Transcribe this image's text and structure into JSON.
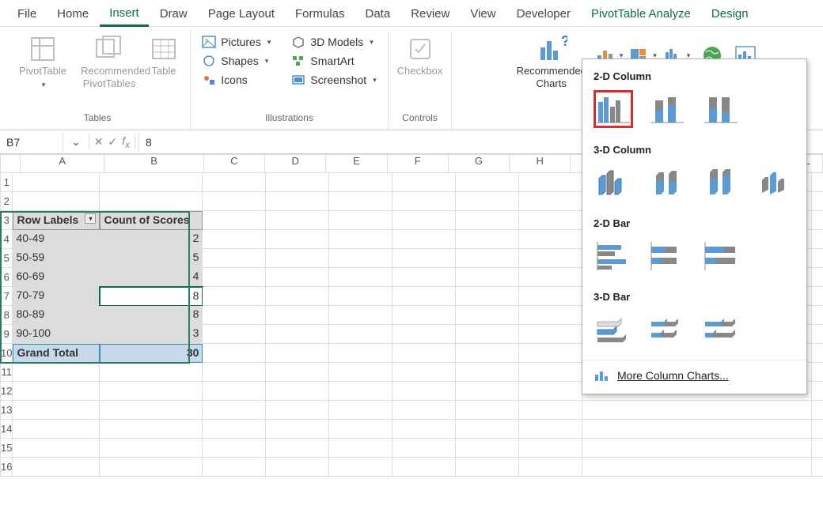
{
  "tabs": [
    "File",
    "Home",
    "Insert",
    "Draw",
    "Page Layout",
    "Formulas",
    "Data",
    "Review",
    "View",
    "Developer",
    "PivotTable Analyze",
    "Design"
  ],
  "active_tab": "Insert",
  "ribbon": {
    "tables": {
      "pivottable": "PivotTable",
      "recommended_pt": "Recommended\nPivotTables",
      "table": "Table",
      "group": "Tables"
    },
    "illustrations": {
      "pictures": "Pictures",
      "shapes": "Shapes",
      "icons": "Icons",
      "models": "3D Models",
      "smartart": "SmartArt",
      "screenshot": "Screenshot",
      "group": "Illustrations"
    },
    "controls": {
      "checkbox": "Checkbox",
      "group": "Controls"
    },
    "charts": {
      "recommended": "Recommended\nCharts"
    }
  },
  "name_box": "B7",
  "formula_bar": "8",
  "columns": [
    "A",
    "B",
    "C",
    "D",
    "E",
    "F",
    "G",
    "H",
    "L"
  ],
  "rows": [
    "1",
    "2",
    "3",
    "4",
    "5",
    "6",
    "7",
    "8",
    "9",
    "10",
    "11",
    "12",
    "13",
    "14",
    "15",
    "16"
  ],
  "pivot": {
    "row_labels": "Row Labels",
    "col_header": "Count of Scores",
    "data": [
      {
        "label": "40-49",
        "count": 2
      },
      {
        "label": "50-59",
        "count": 5
      },
      {
        "label": "60-69",
        "count": 4
      },
      {
        "label": "70-79",
        "count": 8
      },
      {
        "label": "80-89",
        "count": 8
      },
      {
        "label": "90-100",
        "count": 3
      }
    ],
    "grand_label": "Grand Total",
    "grand_count": 30
  },
  "dropdown": {
    "sec1": "2-D Column",
    "sec2": "3-D Column",
    "sec3": "2-D Bar",
    "sec4": "3-D Bar",
    "more": "More Column Charts..."
  }
}
